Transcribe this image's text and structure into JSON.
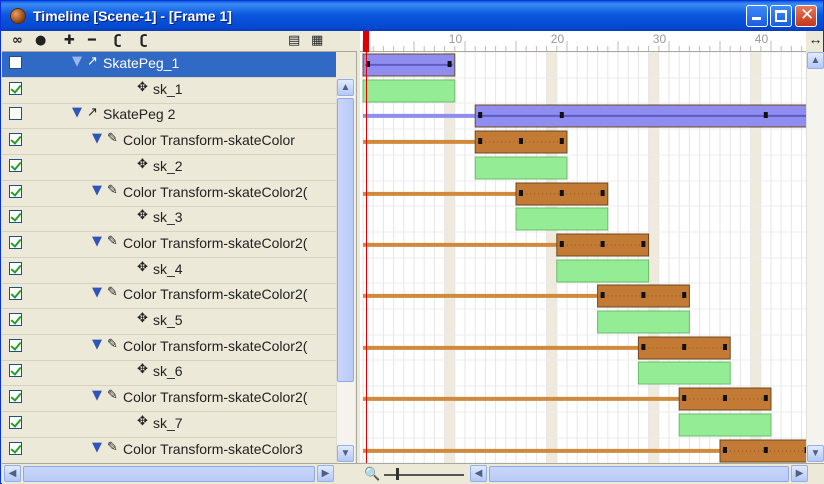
{
  "window": {
    "title": "Timeline [Scene-1] - [Frame 1]"
  },
  "toolbar": {
    "tools": [
      {
        "name": "link-tool-icon",
        "glyph": "∞"
      },
      {
        "name": "record-tool-icon",
        "glyph": "●"
      },
      {
        "name": "add-layer-icon",
        "glyph": "✚"
      },
      {
        "name": "remove-layer-icon",
        "glyph": "━"
      },
      {
        "name": "attach-effect-icon",
        "glyph": "ʗ"
      },
      {
        "name": "detach-effect-icon",
        "glyph": "ʗ"
      },
      {
        "name": "lock-icon",
        "glyph": "▤"
      },
      {
        "name": "layers-icon",
        "glyph": "▦"
      }
    ]
  },
  "ruler": {
    "marks": [
      "10",
      "20",
      "30",
      "40"
    ]
  },
  "layers": [
    {
      "label": "SkatePeg_1",
      "checked": false,
      "selected": true,
      "type": "peg"
    },
    {
      "label": "sk_1",
      "checked": true,
      "selected": false,
      "type": "drawing"
    },
    {
      "label": "SkatePeg 2",
      "checked": false,
      "selected": false,
      "type": "peg"
    },
    {
      "label": "Color Transform-skateColor",
      "checked": true,
      "selected": false,
      "type": "effect"
    },
    {
      "label": "sk_2",
      "checked": true,
      "selected": false,
      "type": "drawing"
    },
    {
      "label": "Color Transform-skateColor2(",
      "checked": true,
      "selected": false,
      "type": "effect"
    },
    {
      "label": "sk_3",
      "checked": true,
      "selected": false,
      "type": "drawing"
    },
    {
      "label": "Color Transform-skateColor2(",
      "checked": true,
      "selected": false,
      "type": "effect"
    },
    {
      "label": "sk_4",
      "checked": true,
      "selected": false,
      "type": "drawing"
    },
    {
      "label": "Color Transform-skateColor2(",
      "checked": true,
      "selected": false,
      "type": "effect"
    },
    {
      "label": "sk_5",
      "checked": true,
      "selected": false,
      "type": "drawing"
    },
    {
      "label": "Color Transform-skateColor2(",
      "checked": true,
      "selected": false,
      "type": "effect"
    },
    {
      "label": "sk_6",
      "checked": true,
      "selected": false,
      "type": "drawing"
    },
    {
      "label": "Color Transform-skateColor2(",
      "checked": true,
      "selected": false,
      "type": "effect"
    },
    {
      "label": "sk_7",
      "checked": true,
      "selected": false,
      "type": "drawing"
    },
    {
      "label": "Color Transform-skateColor3",
      "checked": true,
      "selected": false,
      "type": "effect"
    }
  ],
  "colors": {
    "peg_bar": "#8f8ef0",
    "peg_line": "#5c5cc4",
    "effect_bar": "#c27a34",
    "effect_line": "#d08a3c",
    "drawing_bar": "#94ec94",
    "playhead": "#e00000",
    "selection": "#316ac5"
  },
  "current_frame": 1
}
